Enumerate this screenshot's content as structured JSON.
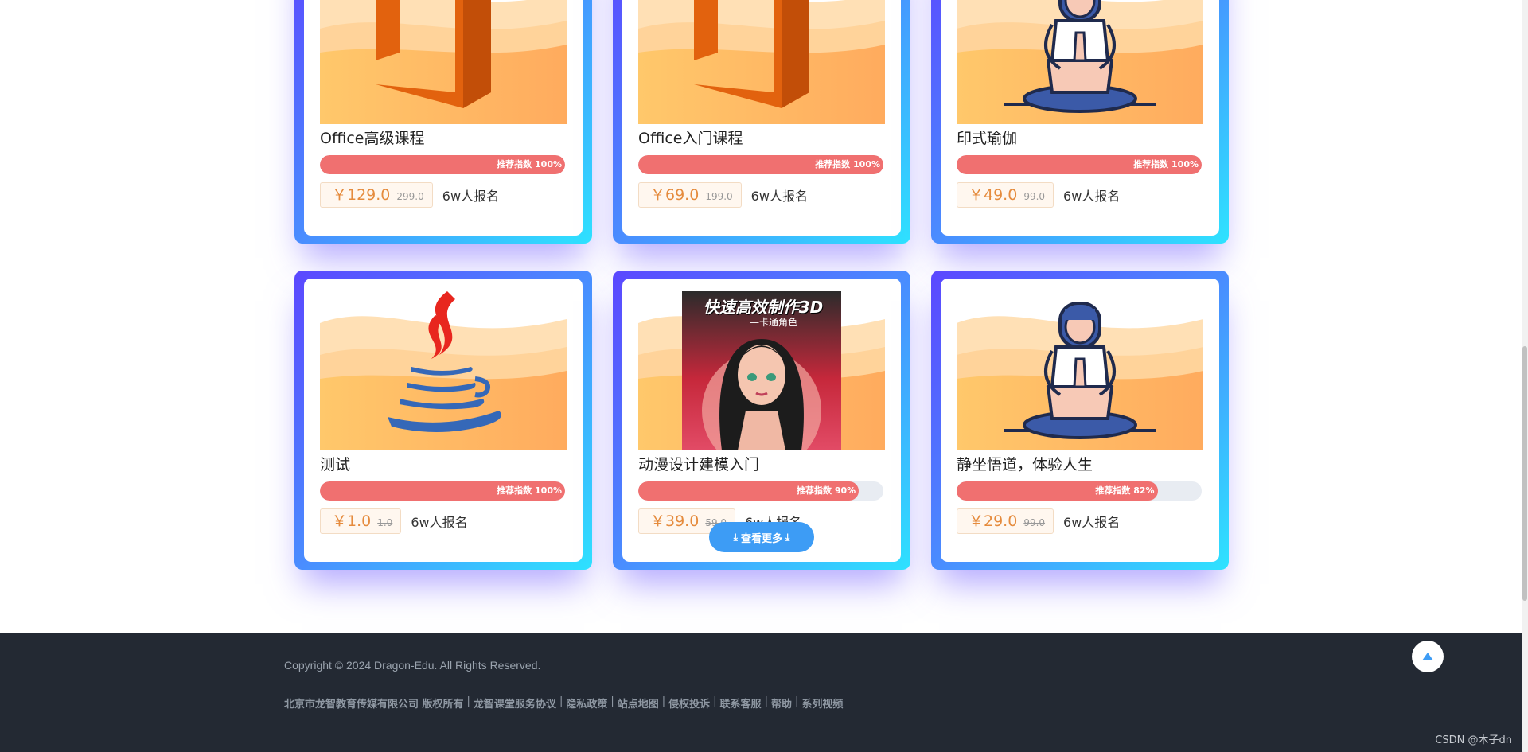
{
  "courses": [
    {
      "title": "Office高级课程",
      "rec_label": "推荐指数 100%",
      "rec_percent": 100,
      "price": "￥129.0",
      "old_price": "299.0",
      "enrolled": "6w人报名",
      "art": "office-logo-icon"
    },
    {
      "title": "Office入门课程",
      "rec_label": "推荐指数 100%",
      "rec_percent": 100,
      "price": "￥69.0",
      "old_price": "199.0",
      "enrolled": "6w人报名",
      "art": "office-logo-icon"
    },
    {
      "title": "印式瑜伽",
      "rec_label": "推荐指数 100%",
      "rec_percent": 100,
      "price": "￥49.0",
      "old_price": "99.0",
      "enrolled": "6w人报名",
      "art": "yoga-icon"
    },
    {
      "title": "测试",
      "rec_label": "推荐指数 100%",
      "rec_percent": 100,
      "price": "￥1.0",
      "old_price": "1.0",
      "enrolled": "6w人报名",
      "art": "java-logo-icon"
    },
    {
      "title": "动漫设计建模入门",
      "rec_label": "推荐指数 90%",
      "rec_percent": 90,
      "price": "￥39.0",
      "old_price": "59.0",
      "enrolled": "6w人报名",
      "art": "anime-girl-poster",
      "poster_title": "快速高效制作3D",
      "poster_subtitle": "—卡通角色"
    },
    {
      "title": "静坐悟道，体验人生",
      "rec_label": "推荐指数 82%",
      "rec_percent": 82,
      "price": "￥29.0",
      "old_price": "99.0",
      "enrolled": "6w人报名",
      "art": "yoga-icon"
    }
  ],
  "more_button": {
    "label": "查看更多",
    "icon": "download-arrow-icon"
  },
  "footer": {
    "copyright": "Copyright © 2024 Dragon-Edu. All Rights Reserved.",
    "links": [
      "北京市龙智教育传媒有限公司 版权所有",
      "龙智课堂服务协议",
      "隐私政策",
      "站点地图",
      "侵权投诉",
      "联系客服",
      "帮助",
      "系列视频"
    ],
    "separator": "|",
    "back_to_top_icon": "arrow-up-icon",
    "watermark": "CSDN @木子dn"
  },
  "colors": {
    "accent_blue": "#3d9cf5",
    "progress_red": "#f07070",
    "price_orange": "#e58b3d",
    "footer_bg": "#232933"
  }
}
